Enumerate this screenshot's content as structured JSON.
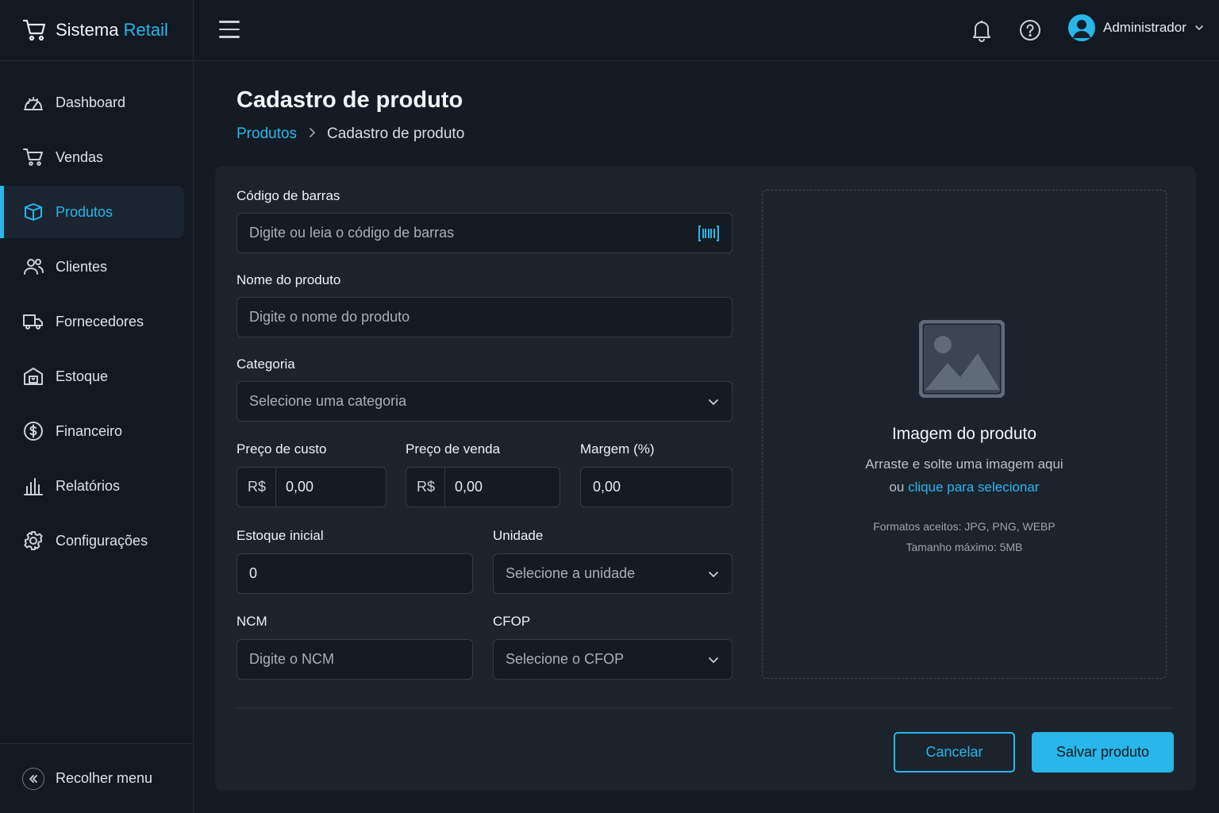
{
  "brand": {
    "name": "Sistema",
    "accent": "Retail",
    "icon": "cart-icon"
  },
  "sidebar": {
    "items": [
      {
        "label": "Dashboard",
        "icon": "gauge-icon",
        "active": false
      },
      {
        "label": "Vendas",
        "icon": "cart-icon",
        "active": false
      },
      {
        "label": "Produtos",
        "icon": "box-icon",
        "active": true
      },
      {
        "label": "Clientes",
        "icon": "users-icon",
        "active": false
      },
      {
        "label": "Fornecedores",
        "icon": "truck-icon",
        "active": false
      },
      {
        "label": "Estoque",
        "icon": "warehouse-icon",
        "active": false
      },
      {
        "label": "Financeiro",
        "icon": "dollar-icon",
        "active": false
      },
      {
        "label": "Relatórios",
        "icon": "bar-chart-icon",
        "active": false
      },
      {
        "label": "Configurações",
        "icon": "gear-icon",
        "active": false
      }
    ],
    "collapse_label": "Recolher menu"
  },
  "topbar": {
    "user_name": "Administrador"
  },
  "page": {
    "title": "Cadastro de produto",
    "breadcrumb": {
      "parent": "Produtos",
      "current": "Cadastro de produto"
    }
  },
  "form": {
    "barcode": {
      "label": "Código de barras",
      "placeholder": "Digite ou leia o código de barras"
    },
    "name": {
      "label": "Nome do produto",
      "placeholder": "Digite o nome do produto"
    },
    "category": {
      "label": "Categoria",
      "placeholder": "Selecione uma categoria"
    },
    "cost": {
      "label": "Preço de custo",
      "prefix": "R$",
      "value": "0,00"
    },
    "sale": {
      "label": "Preço de venda",
      "prefix": "R$",
      "value": "0,00"
    },
    "margin": {
      "label": "Margem (%)",
      "value": "0,00"
    },
    "stock": {
      "label": "Estoque inicial",
      "value": "0"
    },
    "unit": {
      "label": "Unidade",
      "placeholder": "Selecione a unidade"
    },
    "ncm": {
      "label": "NCM",
      "placeholder": "Digite o NCM"
    },
    "cfop": {
      "label": "CFOP",
      "placeholder": "Selecione o CFOP"
    }
  },
  "image_upload": {
    "title": "Imagem do produto",
    "line1": "Arraste e solte uma imagem aqui",
    "line2_prefix": "ou",
    "line2_link": "clique para selecionar",
    "formats": "Formatos aceitos: JPG, PNG, WEBP",
    "max_size": "Tamanho máximo: 5MB"
  },
  "actions": {
    "cancel": "Cancelar",
    "save": "Salvar produto"
  },
  "colors": {
    "accent": "#29b6e8",
    "background": "#141b24",
    "card": "#1b232d"
  }
}
